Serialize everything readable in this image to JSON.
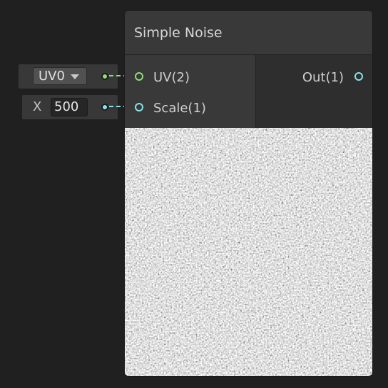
{
  "node": {
    "title": "Simple Noise",
    "inputs": [
      {
        "label": "UV(2)",
        "color": "#8fdc7a"
      },
      {
        "label": "Scale(1)",
        "color": "#84e4e7"
      }
    ],
    "outputs": [
      {
        "label": "Out(1)",
        "color": "#84e4e7"
      }
    ]
  },
  "uv_input": {
    "selected": "UV0"
  },
  "scale_input": {
    "axis_label": "X",
    "value": "500"
  },
  "colors": {
    "background": "#202020",
    "uv_wire": "#8fdc7a",
    "float_wire": "#84e4e7"
  }
}
